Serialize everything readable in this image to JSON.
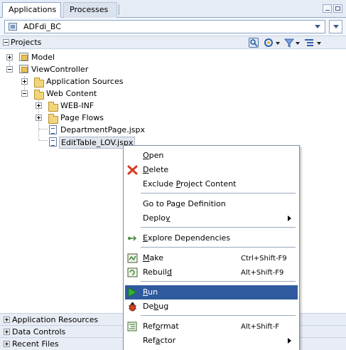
{
  "tabs": [
    {
      "label": "Applications",
      "active": true
    },
    {
      "label": "Processes",
      "active": false
    }
  ],
  "application": {
    "name": "ADFdi_BC"
  },
  "projects_panel": {
    "title": "Projects"
  },
  "tree": {
    "model": "Model",
    "view_controller": "ViewController",
    "application_sources": "Application Sources",
    "web_content": "Web Content",
    "web_inf": "WEB-INF",
    "page_flows": "Page Flows",
    "department_page": "DepartmentPage.jspx",
    "edit_table": "EditTable_LOV.jspx"
  },
  "accordions": {
    "application_resources": "Application Resources",
    "data_controls": "Data Controls",
    "recent_files": "Recent Files"
  },
  "context_menu": {
    "open": {
      "pre": "",
      "key": "O",
      "post": "pen"
    },
    "delete": {
      "pre": "",
      "key": "D",
      "post": "elete"
    },
    "exclude": {
      "pre": "Exclude ",
      "key": "P",
      "post": "roject Content"
    },
    "goto_page_def": {
      "pre": "Go to Pa",
      "key": "g",
      "post": "e Definition"
    },
    "deploy": {
      "pre": "Deplo",
      "key": "y",
      "post": ""
    },
    "explore_deps": {
      "pre": "",
      "key": "E",
      "post": "xplore Dependencies"
    },
    "make": {
      "pre": "",
      "key": "M",
      "post": "ake",
      "shortcut": "Ctrl+Shift-F9"
    },
    "rebuild": {
      "pre": "Rebuil",
      "key": "d",
      "post": "",
      "shortcut": "Alt+Shift-F9"
    },
    "run": {
      "pre": "",
      "key": "R",
      "post": "un"
    },
    "debug": {
      "pre": "De",
      "key": "b",
      "post": "ug"
    },
    "reformat": {
      "pre": "Ref",
      "key": "o",
      "post": "rmat",
      "shortcut": "Alt+Shift-F"
    },
    "refactor": {
      "pre": "Ref",
      "key": "a",
      "post": "ctor"
    }
  },
  "colors": {
    "highlight": "#2f5b9e",
    "tab_border": "#8ea6c9"
  }
}
